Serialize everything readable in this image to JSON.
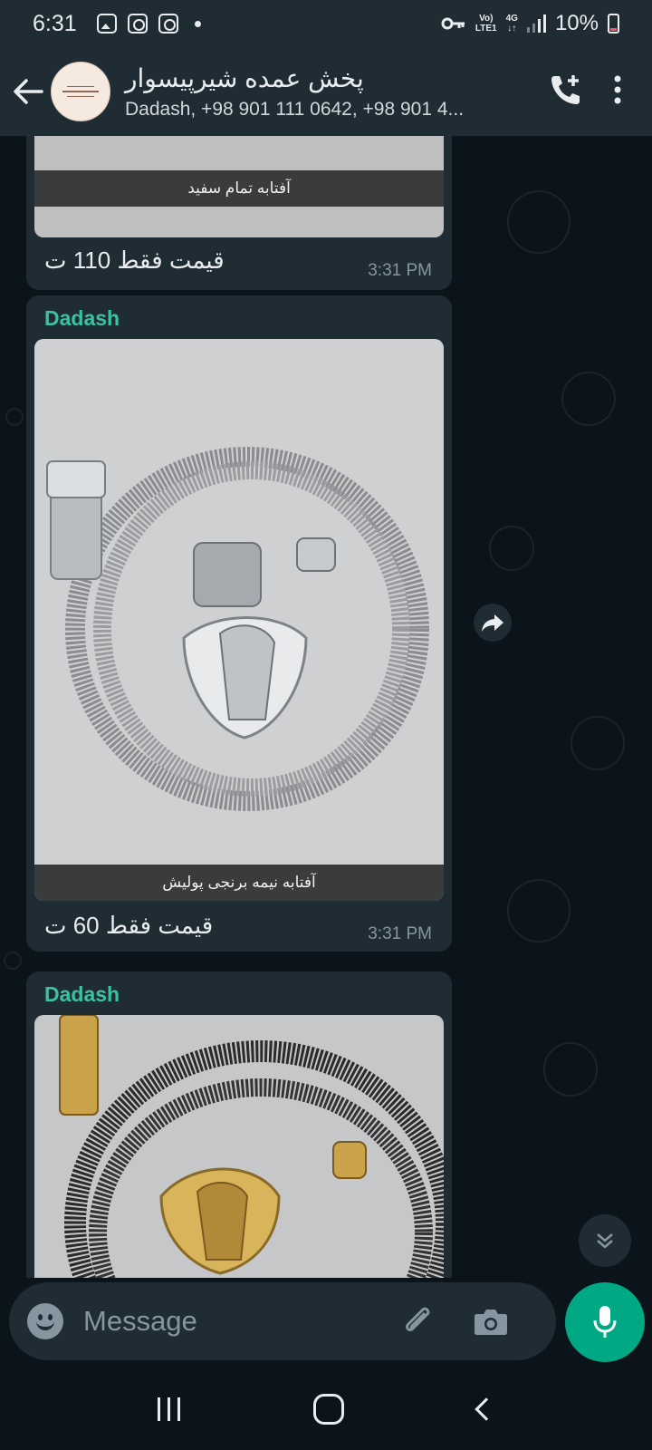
{
  "status_bar": {
    "time": "6:31",
    "network_top": "Vo)",
    "network_bottom": "LTE1",
    "data_type": "4G",
    "battery": "10%"
  },
  "header": {
    "title": "پخش عمده شیرپیسوار",
    "subtitle": "Dadash, +98 901 111 0642, +98 901 4..."
  },
  "messages": [
    {
      "media_caption": "آفتابه تمام سفید",
      "caption": "قیمت فقط 110 ت",
      "time": "3:31 PM"
    },
    {
      "sender": "Dadash",
      "media_caption": "آفتابه نیمه برنجی پولیش",
      "caption": "قیمت فقط 60 ت",
      "time": "3:31 PM"
    },
    {
      "sender": "Dadash"
    }
  ],
  "composer": {
    "placeholder": "Message"
  },
  "colors": {
    "background": "#0b141a",
    "bar": "#1f2c34",
    "accent": "#00a884",
    "sender": "#3bc1a3",
    "muted": "#8696a0"
  },
  "icons": [
    "back-arrow-icon",
    "add-call-icon",
    "more-vert-icon",
    "forward-icon",
    "double-chevron-down-icon",
    "emoji-icon",
    "attach-icon",
    "camera-icon",
    "mic-icon"
  ]
}
